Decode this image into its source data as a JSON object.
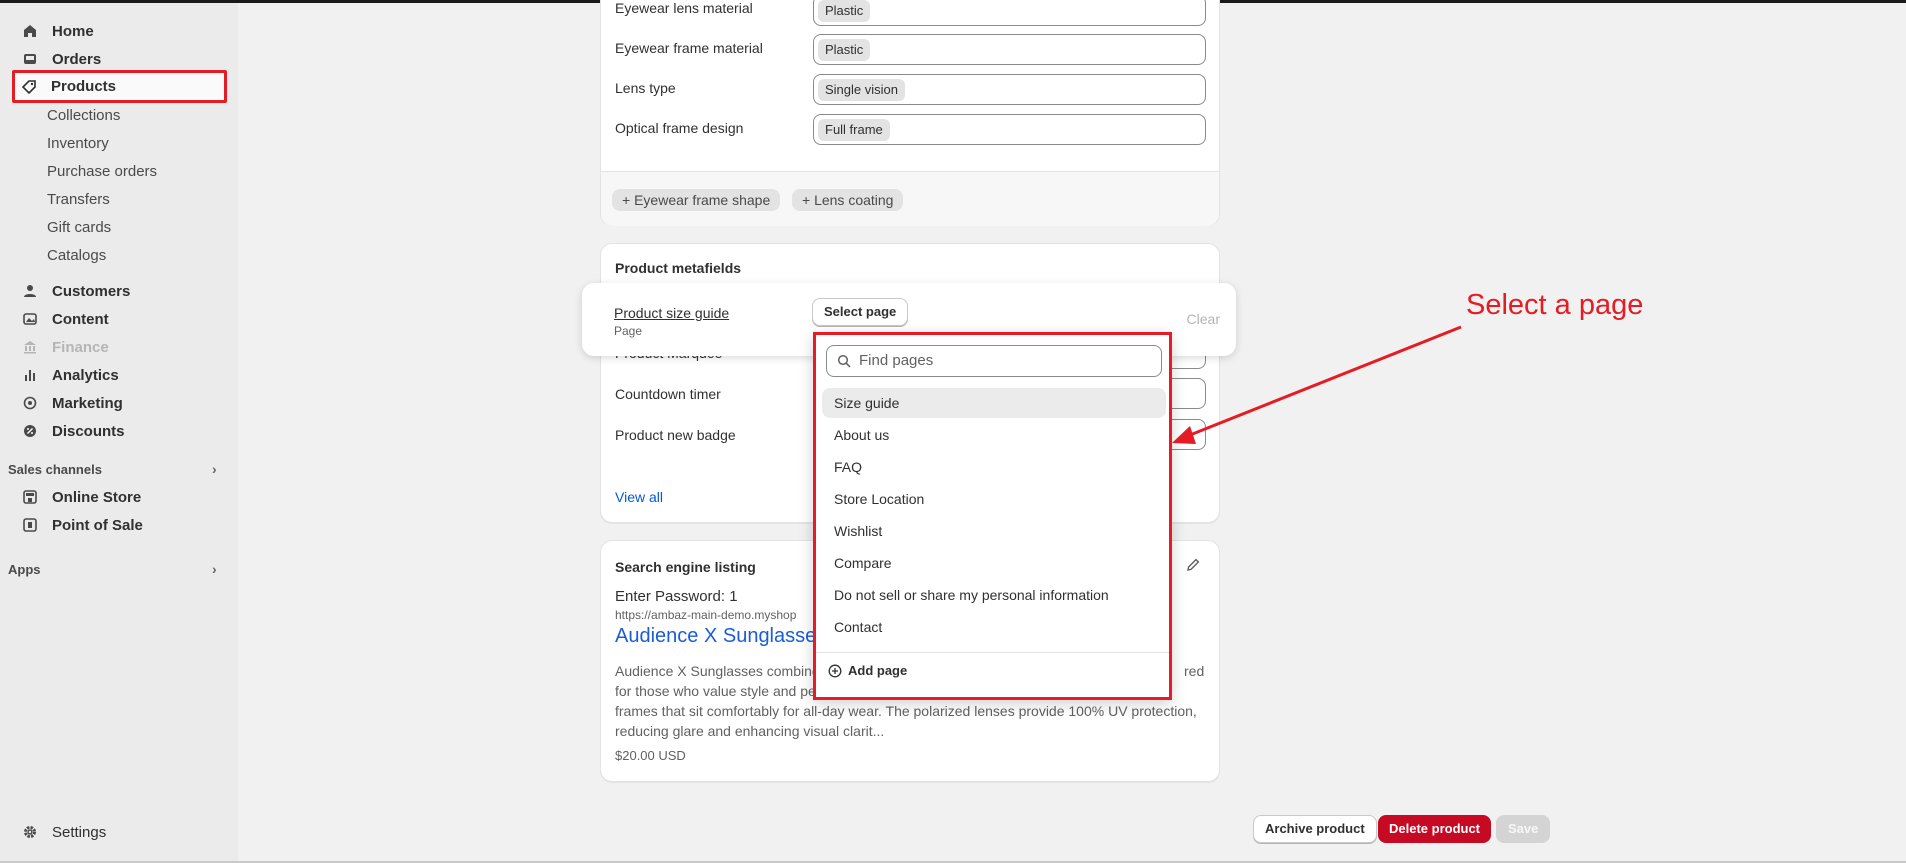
{
  "sidebar": {
    "items": [
      {
        "label": "Home",
        "icon": "home-icon"
      },
      {
        "label": "Orders",
        "icon": "inbox-icon"
      },
      {
        "label": "Products",
        "icon": "tag-icon"
      },
      {
        "label": "Collections"
      },
      {
        "label": "Inventory"
      },
      {
        "label": "Purchase orders"
      },
      {
        "label": "Transfers"
      },
      {
        "label": "Gift cards"
      },
      {
        "label": "Catalogs"
      },
      {
        "label": "Customers",
        "icon": "person-icon"
      },
      {
        "label": "Content",
        "icon": "image-icon"
      },
      {
        "label": "Finance",
        "icon": "bank-icon"
      },
      {
        "label": "Analytics",
        "icon": "bar-chart-icon"
      },
      {
        "label": "Marketing",
        "icon": "target-icon"
      },
      {
        "label": "Discounts",
        "icon": "discount-icon"
      }
    ],
    "sales_channels_label": "Sales channels",
    "channels": [
      {
        "label": "Online Store",
        "icon": "store-icon"
      },
      {
        "label": "Point of Sale",
        "icon": "pos-icon"
      }
    ],
    "apps_label": "Apps",
    "settings_label": "Settings"
  },
  "attributes": {
    "rows": [
      {
        "label": "Eyewear lens material",
        "value": "Plastic"
      },
      {
        "label": "Eyewear frame material",
        "value": "Plastic"
      },
      {
        "label": "Lens type",
        "value": "Single vision"
      },
      {
        "label": "Optical frame design",
        "value": "Full frame"
      }
    ],
    "add_buttons": [
      "Eyewear frame shape",
      "Lens coating"
    ]
  },
  "metafields": {
    "title": "Product metafields",
    "active_field_label": "Product size guide",
    "active_field_type": "Page",
    "select_button": "Select page",
    "clear_label": "Clear",
    "rows": [
      "Product Marquee",
      "Countdown timer",
      "Product new badge"
    ],
    "view_all": "View all"
  },
  "dropdown": {
    "search_placeholder": "Find pages",
    "options": [
      "Size guide",
      "About us",
      "FAQ",
      "Store Location",
      "Wishlist",
      "Compare",
      "Do not sell or share my personal information",
      "Contact"
    ],
    "add_page": "Add page"
  },
  "seo": {
    "title": "Search engine listing",
    "password_line": "Enter Password: 1",
    "url": "https://ambaz-main-demo.myshop",
    "page_title": "Audience X Sunglasse",
    "description_lines": [
      "Audience X Sunglasses combine",
      "red",
      "for those who value style and pe",
      "frames that sit comfortably for all-day wear. The polarized lenses provide 100% UV protection,",
      "reducing glare and enhancing visual clarit..."
    ],
    "price": "$20.00 USD"
  },
  "actions": {
    "archive": "Archive product",
    "delete": "Delete product",
    "save": "Save"
  },
  "annotation": "Select a page",
  "colors": {
    "annotation_red": "#e51c23",
    "delete_red": "#c70a24",
    "link_blue": "#005bd3"
  }
}
